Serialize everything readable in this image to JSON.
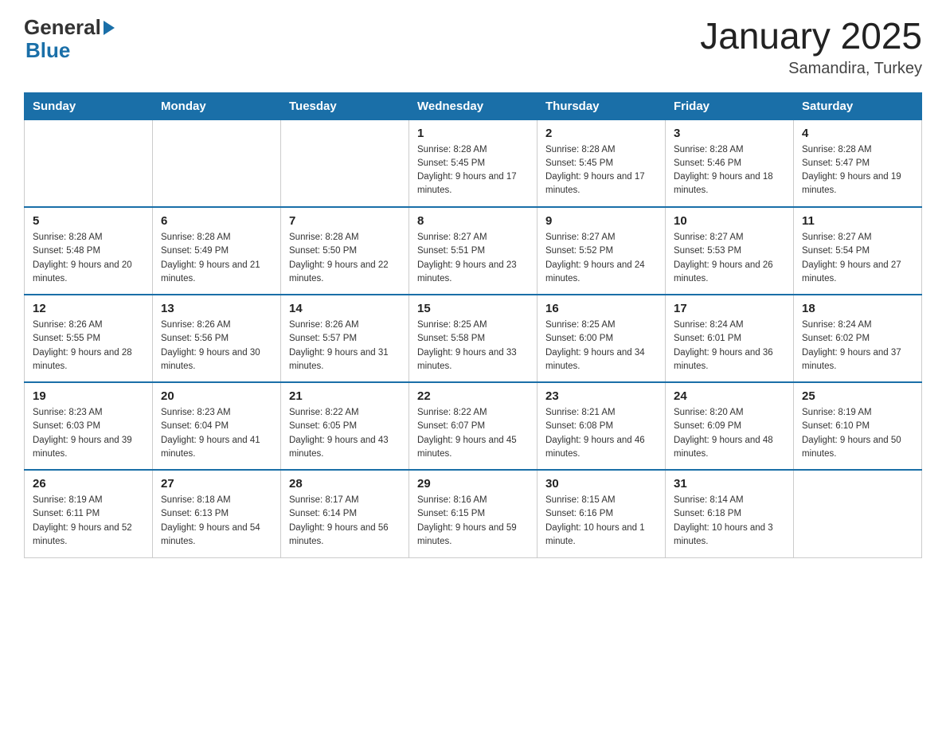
{
  "logo": {
    "general": "General",
    "arrow": "",
    "blue": "Blue"
  },
  "header": {
    "title": "January 2025",
    "subtitle": "Samandira, Turkey"
  },
  "days_of_week": [
    "Sunday",
    "Monday",
    "Tuesday",
    "Wednesday",
    "Thursday",
    "Friday",
    "Saturday"
  ],
  "weeks": [
    [
      {
        "day": "",
        "info": ""
      },
      {
        "day": "",
        "info": ""
      },
      {
        "day": "",
        "info": ""
      },
      {
        "day": "1",
        "info": "Sunrise: 8:28 AM\nSunset: 5:45 PM\nDaylight: 9 hours and 17 minutes."
      },
      {
        "day": "2",
        "info": "Sunrise: 8:28 AM\nSunset: 5:45 PM\nDaylight: 9 hours and 17 minutes."
      },
      {
        "day": "3",
        "info": "Sunrise: 8:28 AM\nSunset: 5:46 PM\nDaylight: 9 hours and 18 minutes."
      },
      {
        "day": "4",
        "info": "Sunrise: 8:28 AM\nSunset: 5:47 PM\nDaylight: 9 hours and 19 minutes."
      }
    ],
    [
      {
        "day": "5",
        "info": "Sunrise: 8:28 AM\nSunset: 5:48 PM\nDaylight: 9 hours and 20 minutes."
      },
      {
        "day": "6",
        "info": "Sunrise: 8:28 AM\nSunset: 5:49 PM\nDaylight: 9 hours and 21 minutes."
      },
      {
        "day": "7",
        "info": "Sunrise: 8:28 AM\nSunset: 5:50 PM\nDaylight: 9 hours and 22 minutes."
      },
      {
        "day": "8",
        "info": "Sunrise: 8:27 AM\nSunset: 5:51 PM\nDaylight: 9 hours and 23 minutes."
      },
      {
        "day": "9",
        "info": "Sunrise: 8:27 AM\nSunset: 5:52 PM\nDaylight: 9 hours and 24 minutes."
      },
      {
        "day": "10",
        "info": "Sunrise: 8:27 AM\nSunset: 5:53 PM\nDaylight: 9 hours and 26 minutes."
      },
      {
        "day": "11",
        "info": "Sunrise: 8:27 AM\nSunset: 5:54 PM\nDaylight: 9 hours and 27 minutes."
      }
    ],
    [
      {
        "day": "12",
        "info": "Sunrise: 8:26 AM\nSunset: 5:55 PM\nDaylight: 9 hours and 28 minutes."
      },
      {
        "day": "13",
        "info": "Sunrise: 8:26 AM\nSunset: 5:56 PM\nDaylight: 9 hours and 30 minutes."
      },
      {
        "day": "14",
        "info": "Sunrise: 8:26 AM\nSunset: 5:57 PM\nDaylight: 9 hours and 31 minutes."
      },
      {
        "day": "15",
        "info": "Sunrise: 8:25 AM\nSunset: 5:58 PM\nDaylight: 9 hours and 33 minutes."
      },
      {
        "day": "16",
        "info": "Sunrise: 8:25 AM\nSunset: 6:00 PM\nDaylight: 9 hours and 34 minutes."
      },
      {
        "day": "17",
        "info": "Sunrise: 8:24 AM\nSunset: 6:01 PM\nDaylight: 9 hours and 36 minutes."
      },
      {
        "day": "18",
        "info": "Sunrise: 8:24 AM\nSunset: 6:02 PM\nDaylight: 9 hours and 37 minutes."
      }
    ],
    [
      {
        "day": "19",
        "info": "Sunrise: 8:23 AM\nSunset: 6:03 PM\nDaylight: 9 hours and 39 minutes."
      },
      {
        "day": "20",
        "info": "Sunrise: 8:23 AM\nSunset: 6:04 PM\nDaylight: 9 hours and 41 minutes."
      },
      {
        "day": "21",
        "info": "Sunrise: 8:22 AM\nSunset: 6:05 PM\nDaylight: 9 hours and 43 minutes."
      },
      {
        "day": "22",
        "info": "Sunrise: 8:22 AM\nSunset: 6:07 PM\nDaylight: 9 hours and 45 minutes."
      },
      {
        "day": "23",
        "info": "Sunrise: 8:21 AM\nSunset: 6:08 PM\nDaylight: 9 hours and 46 minutes."
      },
      {
        "day": "24",
        "info": "Sunrise: 8:20 AM\nSunset: 6:09 PM\nDaylight: 9 hours and 48 minutes."
      },
      {
        "day": "25",
        "info": "Sunrise: 8:19 AM\nSunset: 6:10 PM\nDaylight: 9 hours and 50 minutes."
      }
    ],
    [
      {
        "day": "26",
        "info": "Sunrise: 8:19 AM\nSunset: 6:11 PM\nDaylight: 9 hours and 52 minutes."
      },
      {
        "day": "27",
        "info": "Sunrise: 8:18 AM\nSunset: 6:13 PM\nDaylight: 9 hours and 54 minutes."
      },
      {
        "day": "28",
        "info": "Sunrise: 8:17 AM\nSunset: 6:14 PM\nDaylight: 9 hours and 56 minutes."
      },
      {
        "day": "29",
        "info": "Sunrise: 8:16 AM\nSunset: 6:15 PM\nDaylight: 9 hours and 59 minutes."
      },
      {
        "day": "30",
        "info": "Sunrise: 8:15 AM\nSunset: 6:16 PM\nDaylight: 10 hours and 1 minute."
      },
      {
        "day": "31",
        "info": "Sunrise: 8:14 AM\nSunset: 6:18 PM\nDaylight: 10 hours and 3 minutes."
      },
      {
        "day": "",
        "info": ""
      }
    ]
  ]
}
